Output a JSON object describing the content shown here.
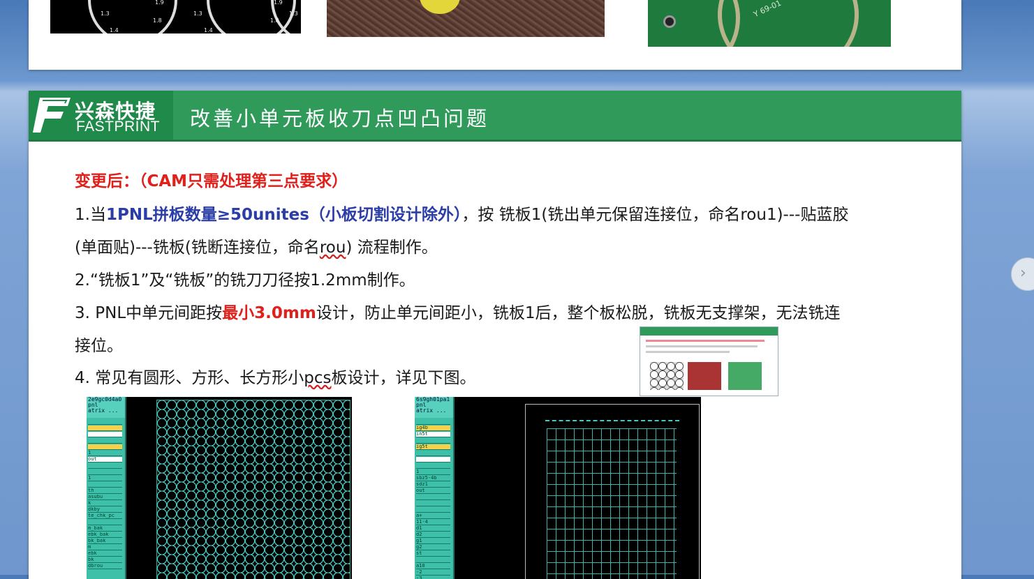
{
  "prev_slide": {
    "gauge_labels": [
      "1.9",
      "1.3",
      "1.8",
      "1.4",
      "1.9",
      "1.3",
      "1.8",
      "1.4",
      "1.3"
    ],
    "pcb_text": "Y 69-01"
  },
  "slide": {
    "logo_cn": "兴森快捷",
    "logo_en": "FASTPRINT",
    "title": "改善小单元板收刀点凹凸问题",
    "heading": "变更后：（CAM只需处理第三点要求）",
    "item1": {
      "prefix": "1.当",
      "highlight": "1PNL拼板数量≥50unites（小板切割设计除外）",
      "rest": "，按 铣板1(铣出单元保留连接位，命名rou1)---贴蓝胶",
      "line2_a": "(单面贴)---铣板(铣断连接位，命名",
      "line2_u": "rou",
      "line2_b": ") 流程制作。"
    },
    "item2": "2.“铣板1”及“铣板”的铣刀刀径按1.2mm制作。",
    "item3": {
      "prefix": "3. PNL中单元间距按",
      "highlight": "最小3.0mm",
      "rest": "设计，防止单元间距小，铣板1后，整个板松脱，铣板无支撑架，无法铣连",
      "line2": "接位。"
    },
    "item4": {
      "a": "4. 常见有圆形、方形、长方形小",
      "u": "pcs",
      "b": "板设计，详见下图。"
    }
  },
  "cam1": {
    "head": [
      "2e9gc0d4a0",
      "pnl",
      "atrix ..."
    ],
    "rows": [
      "",
      "",
      "",
      "",
      "",
      "1",
      "out",
      "",
      "",
      "1",
      "",
      "th",
      "asubu",
      "k",
      "dkby",
      "te_chk_pc",
      "",
      "m_bak",
      "ebk_bak",
      "bk_bak",
      "m",
      "ebk",
      "bk",
      "dbrou"
    ]
  },
  "cam2": {
    "head": [
      "6s9gh01pa1",
      "pnl",
      "atrix ..."
    ],
    "rows": [
      "",
      "ig4b",
      "in5t",
      "",
      "ig5t",
      "",
      "",
      "",
      "1",
      "sbz5-4b",
      "sdz1",
      "out",
      "",
      "",
      "",
      "a+",
      "11-4",
      "d1",
      "d2",
      "g1",
      "g2",
      "st",
      "",
      "a10",
      "-2",
      "-3",
      "",
      "ioqbu"
    ]
  },
  "colors": {
    "header_green": "#2f9a59",
    "highlight_red": "#e0201b",
    "highlight_blue": "#2b3ea8",
    "cam_teal": "#3ec0a8"
  },
  "icons": {
    "nav_next": "chevron-right-icon",
    "logo": "fastprint-logo"
  }
}
